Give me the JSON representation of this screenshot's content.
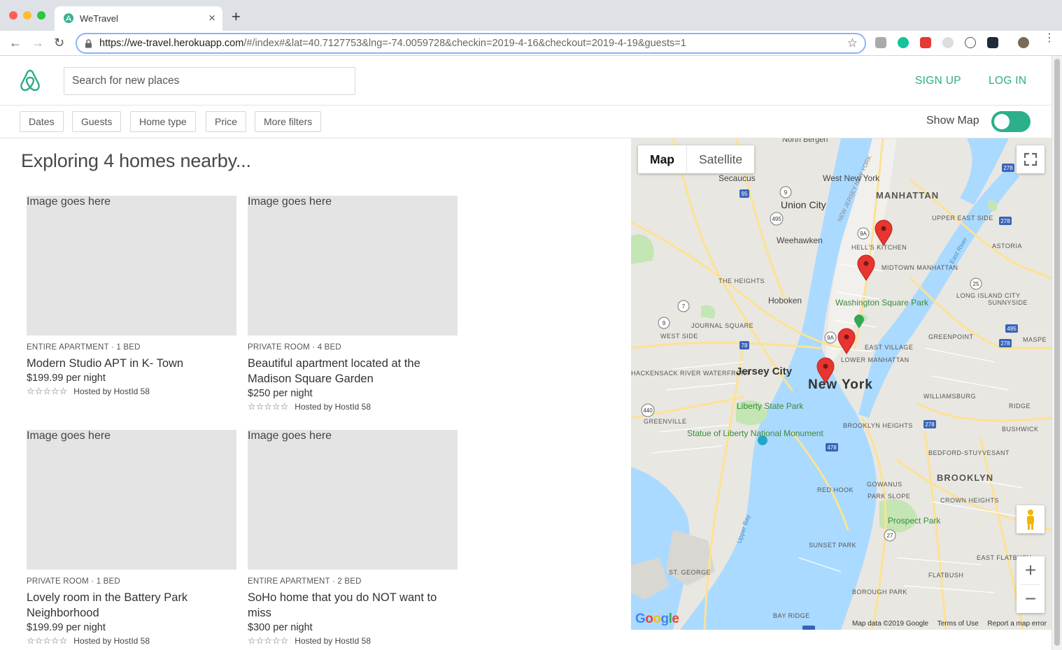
{
  "browser": {
    "tab_title": "WeTravel",
    "tab_close": "×",
    "new_tab": "+",
    "url_host": "https://we-travel.herokuapp.com",
    "url_path": "/#/index#&lat=40.7127753&lng=-74.0059728&checkin=2019-4-16&checkout=2019-4-19&guests=1",
    "bookmark_icon": "star-icon"
  },
  "header": {
    "search_placeholder": "Search for new places",
    "sign_up": "SIGN UP",
    "log_in": "LOG IN",
    "brand_color": "#2cab8b"
  },
  "filters": {
    "buttons": [
      "Dates",
      "Guests",
      "Home type",
      "Price",
      "More filters"
    ],
    "show_map_label": "Show Map",
    "show_map_on": true
  },
  "main": {
    "heading": "Exploring 4 homes nearby..."
  },
  "listings": [
    {
      "image_text": "Image goes here",
      "type": "ENTIRE APARTMENT · 1 BED",
      "title": "Modern Studio APT in K- Town",
      "price": "$199.99 per night",
      "stars": "☆☆☆☆☆",
      "host": "Hosted by HostId 58"
    },
    {
      "image_text": "Image goes here",
      "type": "PRIVATE ROOM · 4 BED",
      "title": "Beautiful apartment located at the Madison Square Garden",
      "price": "$250 per night",
      "stars": "☆☆☆☆☆",
      "host": "Hosted by HostId 58"
    },
    {
      "image_text": "Image goes here",
      "type": "PRIVATE ROOM · 1 BED",
      "title": "Lovely room in the Battery Park Neighborhood",
      "price": "$199.99 per night",
      "stars": "☆☆☆☆☆",
      "host": "Hosted by HostId 58"
    },
    {
      "image_text": "Image goes here",
      "type": "ENTIRE APARTMENT · 2 BED",
      "title": "SoHo home that you do NOT want to miss",
      "price": "$300 per night",
      "stars": "☆☆☆☆☆",
      "host": "Hosted by HostId 58"
    }
  ],
  "map": {
    "map_button": "Map",
    "satellite_button": "Satellite",
    "zoom_in": "+",
    "zoom_out": "−",
    "google": "Google",
    "footer": [
      "Map data ©2019 Google",
      "Terms of Use",
      "Report a map error"
    ],
    "labels": {
      "manhattan": "MANHATTAN",
      "new_york": "New York",
      "jersey_city": "Jersey City",
      "hoboken": "Hoboken",
      "union_city": "Union City",
      "weehawken": "Weehawken",
      "secaucus": "Secaucus",
      "west_new_york": "West New York",
      "brooklyn": "BROOKLYN",
      "washington_square_park": "Washington Square Park",
      "liberty_state_park": "Liberty State Park",
      "statue_of_liberty": "Statue of Liberty National Monument",
      "prospect_park": "Prospect Park",
      "astoria": "ASTORIA",
      "greenpoint": "GREENPOINT",
      "williamsburg": "WILLIAMSBURG",
      "east_village": "EAST VILLAGE",
      "lower_manhattan": "LOWER MANHATTAN",
      "midtown_manhattan": "MIDTOWN MANHATTAN",
      "hells_kitchen": "HELL'S KITCHEN",
      "upper_east_side": "UPPER EAST SIDE",
      "long_island_city": "LONG ISLAND CITY",
      "sunnyside": "SUNNYSIDE",
      "the_heights": "THE HEIGHTS",
      "journal_square": "JOURNAL SQUARE",
      "west_side": "WEST SIDE",
      "hackensack_river_waterfront": "HACKENSACK RIVER WATERFRONT",
      "greenville": "GREENVILLE",
      "brooklyn_heights": "BROOKLYN HEIGHTS",
      "bedford_stuyvesant": "BEDFORD-STUYVESANT",
      "crown_heights": "CROWN HEIGHTS",
      "red_hook": "RED HOOK",
      "gowanus": "GOWANUS",
      "park_slope": "PARK SLOPE",
      "sunset_park": "SUNSET PARK",
      "east_flatbush": "EAST FLATBUSH",
      "flatbush": "FLATBUSH",
      "borough_park": "BOROUGH PARK",
      "bay_ridge": "BAY RIDGE",
      "st_george": "ST. GEORGE",
      "bushwick": "BUSHWICK",
      "ridgewood": "RIDGE",
      "maspeth": "MASPE",
      "north_bergen": "North Bergen",
      "upper_bay": "Upper Bay",
      "east_river": "East River",
      "new_jersey_new_york": "NEW JERSEY NEW YORK"
    },
    "marker_color": "#e8352f",
    "water_color": "#aadaff",
    "land_color": "#e9e7e2",
    "park_color": "#c3e6b4",
    "road_color": "#fde293"
  }
}
